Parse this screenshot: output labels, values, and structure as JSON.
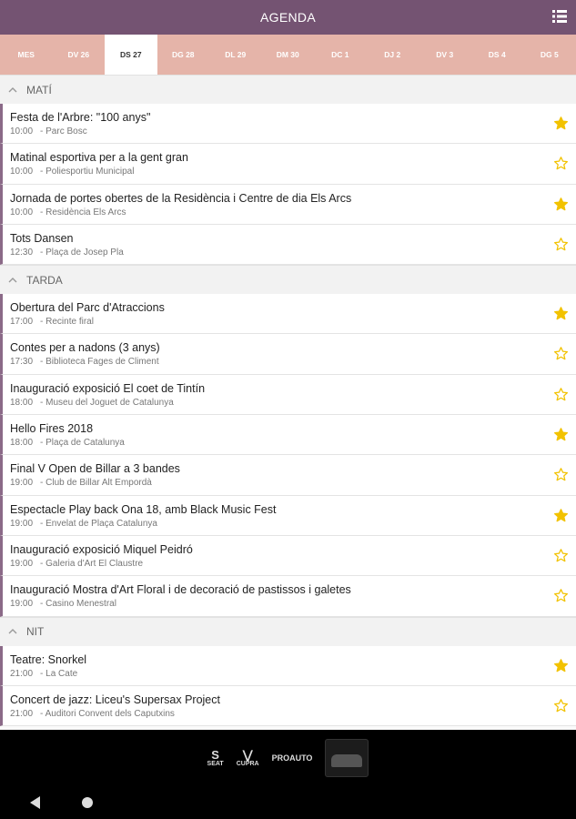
{
  "appbar": {
    "title": "AGENDA",
    "menu_icon": "list-icon"
  },
  "tabs": [
    {
      "label": "MES",
      "active": false
    },
    {
      "label": "DV 26",
      "active": false
    },
    {
      "label": "DS 27",
      "active": true
    },
    {
      "label": "DG 28",
      "active": false
    },
    {
      "label": "DL 29",
      "active": false
    },
    {
      "label": "DM 30",
      "active": false
    },
    {
      "label": "DC 1",
      "active": false
    },
    {
      "label": "DJ 2",
      "active": false
    },
    {
      "label": "DV 3",
      "active": false
    },
    {
      "label": "DS 4",
      "active": false
    },
    {
      "label": "DG 5",
      "active": false
    }
  ],
  "colors": {
    "appbar": "#745372",
    "tabs": "#e5b4a9",
    "accent_border": "#8b6a88",
    "star": "#f2c200"
  },
  "sections": [
    {
      "label": "MATÍ",
      "events": [
        {
          "title": "Festa de l'Arbre: \"100 anys\"",
          "time": "10:00",
          "place": "- Parc Bosc",
          "starred": true
        },
        {
          "title": "Matinal esportiva per a la gent gran",
          "time": "10:00",
          "place": "- Poliesportiu Municipal",
          "starred": false
        },
        {
          "title": "Jornada de portes obertes de la Residència i Centre de dia Els Arcs",
          "time": "10:00",
          "place": "- Residència Els Arcs",
          "starred": true
        },
        {
          "title": "Tots Dansen",
          "time": "12:30",
          "place": "- Plaça de Josep Pla",
          "starred": false
        }
      ]
    },
    {
      "label": "TARDA",
      "events": [
        {
          "title": "Obertura del Parc d'Atraccions",
          "time": "17:00",
          "place": "- Recinte firal",
          "starred": true
        },
        {
          "title": "Contes per a nadons (3 anys)",
          "time": "17:30",
          "place": "- Biblioteca Fages de Climent",
          "starred": false
        },
        {
          "title": "Inauguració exposició El coet de Tintín",
          "time": "18:00",
          "place": "- Museu del Joguet de Catalunya",
          "starred": false
        },
        {
          "title": "Hello Fires 2018",
          "time": "18:00",
          "place": "- Plaça de Catalunya",
          "starred": true
        },
        {
          "title": "Final V Open de Billar a 3 bandes",
          "time": "19:00",
          "place": "- Club de Billar Alt Empordà",
          "starred": false
        },
        {
          "title": "Espectacle Play back Ona 18, amb Black Music Fest",
          "time": "19:00",
          "place": "- Envelat de Plaça Catalunya",
          "starred": true
        },
        {
          "title": "Inauguració exposició Miquel Peidró",
          "time": "19:00",
          "place": "- Galeria d'Art El Claustre",
          "starred": false
        },
        {
          "title": "Inauguració Mostra d'Art Floral i de decoració de pastissos i galetes",
          "time": "19:00",
          "place": "- Casino Menestral",
          "starred": false
        }
      ]
    },
    {
      "label": "NIT",
      "events": [
        {
          "title": "Teatre: Snorkel",
          "time": "21:00",
          "place": "- La Cate",
          "starred": true
        },
        {
          "title": "Concert de jazz: Liceu's Supersax Project",
          "time": "21:00",
          "place": "- Auditori Convent dels Caputxins",
          "starred": false
        }
      ]
    }
  ],
  "sponsors": [
    {
      "name": "SEAT",
      "icon": "seat-logo"
    },
    {
      "name": "CUPRA",
      "icon": "cupra-logo"
    },
    {
      "name": "PROAUTO",
      "icon": "proauto-logo"
    }
  ],
  "system_nav": {
    "back_icon": "back-icon",
    "home_icon": "home-icon"
  }
}
